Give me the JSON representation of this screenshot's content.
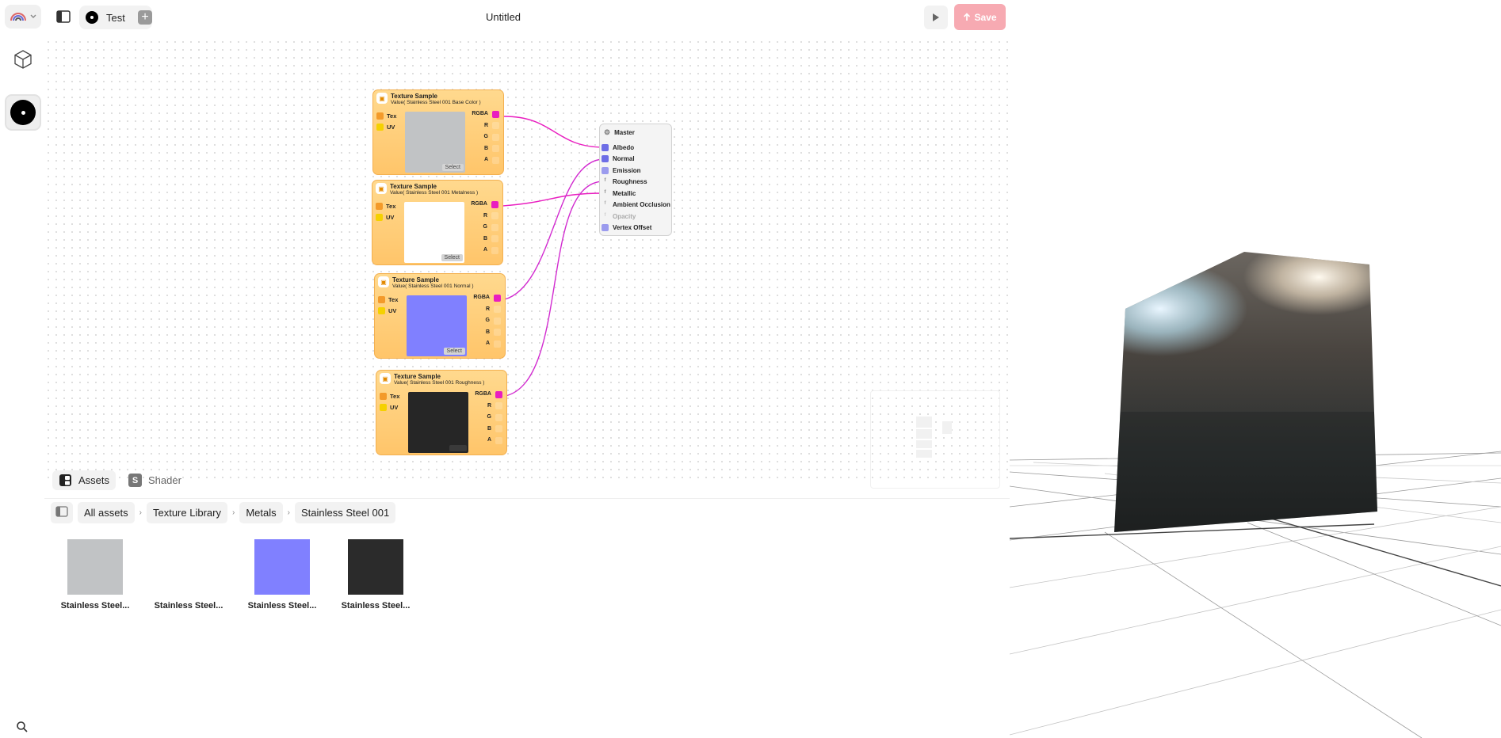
{
  "topbar": {
    "project_tab": "Test",
    "title": "Untitled",
    "save_label": "Save"
  },
  "nodes": [
    {
      "title": "Texture Sample",
      "subtitle": "Value( Stainless Steel 001 Base Color )",
      "in_tex": "Tex",
      "in_uv": "UV",
      "out_rgba": "RGBA",
      "outs": [
        "R",
        "G",
        "B",
        "A"
      ],
      "select": "Select",
      "preview_color": "#c1c3c5"
    },
    {
      "title": "Texture Sample",
      "subtitle": "Value( Stainless Steel 001 Metalness )",
      "in_tex": "Tex",
      "in_uv": "UV",
      "out_rgba": "RGBA",
      "outs": [
        "R",
        "G",
        "B",
        "A"
      ],
      "select": "Select",
      "preview_color": "#ffffff"
    },
    {
      "title": "Texture Sample",
      "subtitle": "Value( Stainless Steel 001 Normal )",
      "in_tex": "Tex",
      "in_uv": "UV",
      "out_rgba": "RGBA",
      "outs": [
        "R",
        "G",
        "B",
        "A"
      ],
      "select": "Select",
      "preview_color": "#8080ff"
    },
    {
      "title": "Texture Sample",
      "subtitle": "Value( Stainless Steel 001 Roughness )",
      "in_tex": "Tex",
      "in_uv": "UV",
      "out_rgba": "RGBA",
      "outs": [
        "R",
        "G",
        "B",
        "A"
      ],
      "select": "",
      "preview_color": "#262626"
    }
  ],
  "master": {
    "title": "Master",
    "inputs": [
      "Albedo",
      "Normal",
      "Emission",
      "Roughness",
      "Metallic",
      "Ambient Occlusion",
      "Opacity",
      "Vertex Offset"
    ]
  },
  "bottom": {
    "tabs": [
      "Assets",
      "Shader"
    ],
    "breadcrumb": [
      "All assets",
      "Texture Library",
      "Metals",
      "Stainless Steel 001"
    ],
    "assets": [
      {
        "label": "Stainless Steel...",
        "color": "#c1c3c5"
      },
      {
        "label": "Stainless Steel...",
        "color": "#ffffff"
      },
      {
        "label": "Stainless Steel...",
        "color": "#8080ff"
      },
      {
        "label": "Stainless Steel...",
        "color": "#2b2b2b"
      }
    ]
  },
  "colors": {
    "accent": "#e91ec0",
    "save_bg": "#f7aab2",
    "node_bg": "#ffc56a"
  }
}
